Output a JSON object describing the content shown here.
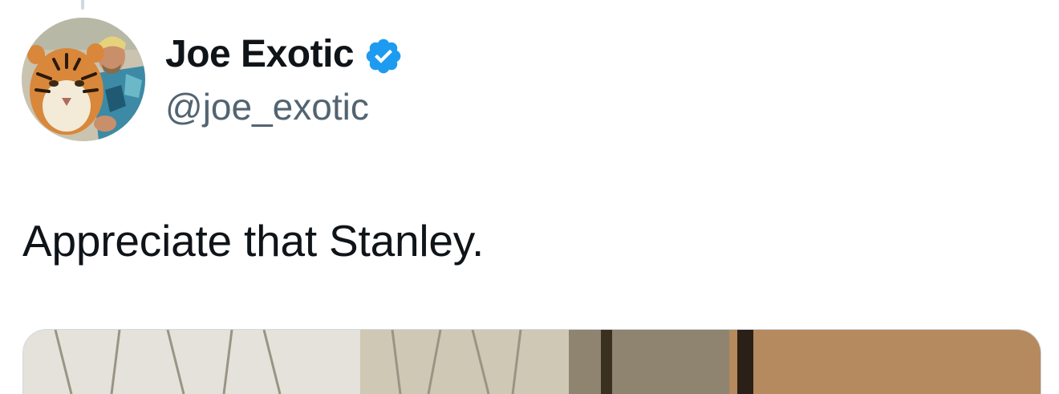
{
  "tweet": {
    "author": {
      "display_name": "Joe Exotic",
      "handle": "@joe_exotic",
      "verified": true,
      "avatar_icon": "profile-photo-with-tiger"
    },
    "text": "Appreciate that Stanley.",
    "media": {
      "type": "photo",
      "description_icon": "attached-photo"
    }
  },
  "colors": {
    "text_primary": "#0f1419",
    "text_secondary": "#536471",
    "verified_blue": "#1d9bf0",
    "thread_line": "#cfd9de"
  }
}
